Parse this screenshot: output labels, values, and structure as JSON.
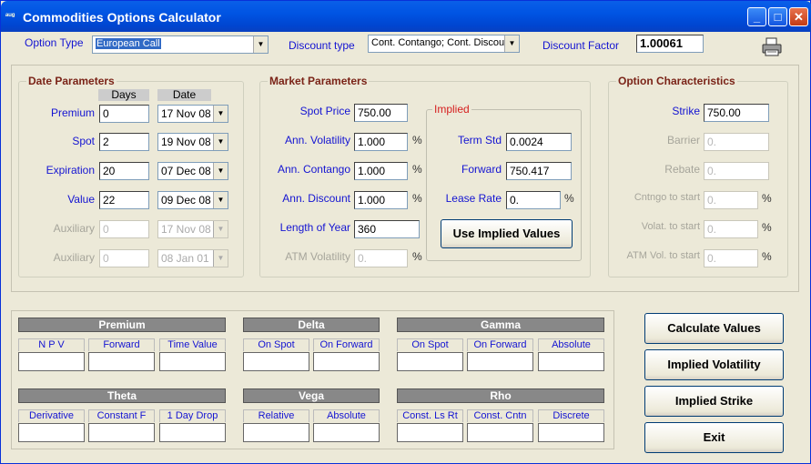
{
  "window": {
    "title": "Commodities Options Calculator",
    "icon_text": "ᵃᵘᵍ"
  },
  "toolbar": {
    "option_type_label": "Option Type",
    "option_type_value": "European Call",
    "discount_type_label": "Discount type",
    "discount_type_value": "Cont. Contango; Cont. Discou",
    "discount_factor_label": "Discount Factor",
    "discount_factor_value": "1.00061",
    "print_icon": "printer-icon"
  },
  "date_params": {
    "title": "Date Parameters",
    "days_header": "Days",
    "date_header": "Date",
    "rows": [
      {
        "label": "Premium",
        "days": "0",
        "date": "17 Nov 08",
        "enabled": true
      },
      {
        "label": "Spot",
        "days": "2",
        "date": "19 Nov 08",
        "enabled": true
      },
      {
        "label": "Expiration",
        "days": "20",
        "date": "07 Dec 08",
        "enabled": true
      },
      {
        "label": "Value",
        "days": "22",
        "date": "09 Dec 08",
        "enabled": true
      },
      {
        "label": "Auxiliary",
        "days": "0",
        "date": "17 Nov 08",
        "enabled": false
      },
      {
        "label": "Auxiliary",
        "days": "0",
        "date": "08 Jan 01",
        "enabled": false
      }
    ]
  },
  "market_params": {
    "title": "Market Parameters",
    "rows": [
      {
        "label": "Spot Price",
        "value": "750.00",
        "unit": "",
        "enabled": true
      },
      {
        "label": "Ann. Volatility",
        "value": "1.000",
        "unit": "%",
        "enabled": true
      },
      {
        "label": "Ann. Contango",
        "value": "1.000",
        "unit": "%",
        "enabled": true
      },
      {
        "label": "Ann. Discount",
        "value": "1.000",
        "unit": "%",
        "enabled": true
      },
      {
        "label": "Length of Year",
        "value": "360",
        "unit": "",
        "enabled": true
      },
      {
        "label": "ATM Volatility",
        "value": "0.",
        "unit": "%",
        "enabled": false
      }
    ],
    "implied": {
      "title": "Implied",
      "rows": [
        {
          "label": "Term Std",
          "value": "0.0024",
          "unit": ""
        },
        {
          "label": "Forward",
          "value": "750.417",
          "unit": ""
        },
        {
          "label": "Lease Rate",
          "value": "0.",
          "unit": "%"
        }
      ],
      "button_label": "Use Implied Values"
    }
  },
  "option_chars": {
    "title": "Option Characteristics",
    "rows": [
      {
        "label": "Strike",
        "value": "750.00",
        "unit": "",
        "enabled": true
      },
      {
        "label": "Barrier",
        "value": "0.",
        "unit": "",
        "enabled": false
      },
      {
        "label": "Rebate",
        "value": "0.",
        "unit": "",
        "enabled": false
      },
      {
        "label": "Cntngo to start",
        "value": "0.",
        "unit": "%",
        "enabled": false
      },
      {
        "label": "Volat. to start",
        "value": "0.",
        "unit": "%",
        "enabled": false
      },
      {
        "label": "ATM Vol. to start",
        "value": "0.",
        "unit": "%",
        "enabled": false
      }
    ]
  },
  "results": {
    "premium": {
      "title": "Premium",
      "cols": [
        "N P V",
        "Forward",
        "Time Value"
      ]
    },
    "delta": {
      "title": "Delta",
      "cols": [
        "On Spot",
        "On Forward"
      ]
    },
    "gamma": {
      "title": "Gamma",
      "cols": [
        "On Spot",
        "On Forward",
        "Absolute"
      ]
    },
    "theta": {
      "title": "Theta",
      "cols": [
        "Derivative",
        "Constant F",
        "1 Day Drop"
      ]
    },
    "vega": {
      "title": "Vega",
      "cols": [
        "Relative",
        "Absolute"
      ]
    },
    "rho": {
      "title": "Rho",
      "cols": [
        "Const. Ls Rt",
        "Const. Cntn",
        "Discrete"
      ]
    }
  },
  "actions": {
    "calculate": "Calculate Values",
    "implied_volatility": "Implied Volatility",
    "implied_strike": "Implied Strike",
    "exit": "Exit"
  }
}
